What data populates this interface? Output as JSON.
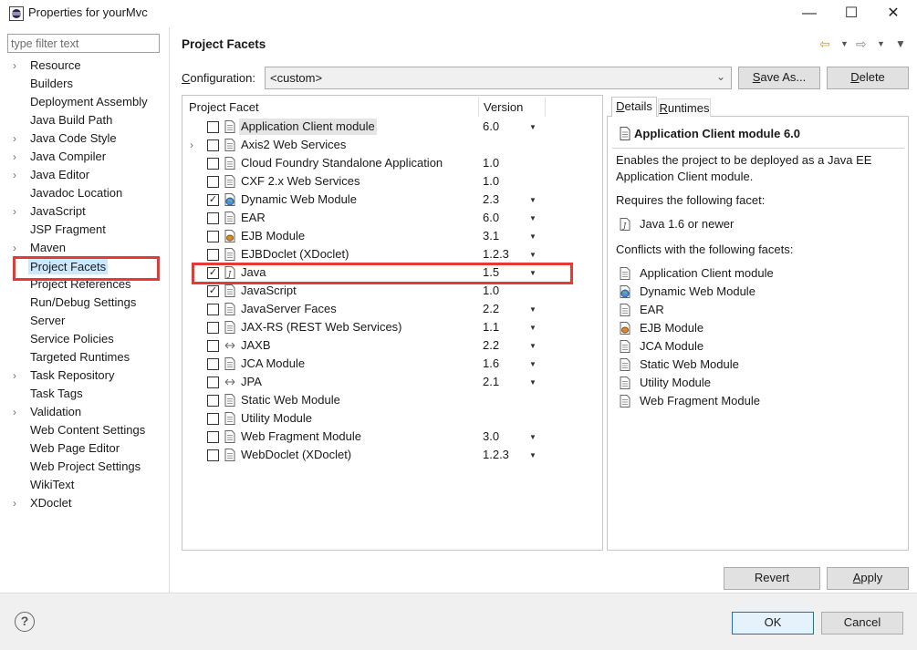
{
  "window": {
    "title": "Properties for yourMvc",
    "min_glyph": "—",
    "max_glyph": "☐",
    "close_glyph": "✕"
  },
  "filter": {
    "placeholder": "type filter text"
  },
  "nav": {
    "items": [
      {
        "label": "Resource",
        "expandable": true
      },
      {
        "label": "Builders",
        "expandable": false
      },
      {
        "label": "Deployment Assembly",
        "expandable": false
      },
      {
        "label": "Java Build Path",
        "expandable": false
      },
      {
        "label": "Java Code Style",
        "expandable": true
      },
      {
        "label": "Java Compiler",
        "expandable": true
      },
      {
        "label": "Java Editor",
        "expandable": true
      },
      {
        "label": "Javadoc Location",
        "expandable": false
      },
      {
        "label": "JavaScript",
        "expandable": true
      },
      {
        "label": "JSP Fragment",
        "expandable": false
      },
      {
        "label": "Maven",
        "expandable": true
      },
      {
        "label": "Project Facets",
        "expandable": false,
        "selected": true
      },
      {
        "label": "Project References",
        "expandable": false
      },
      {
        "label": "Run/Debug Settings",
        "expandable": false
      },
      {
        "label": "Server",
        "expandable": false
      },
      {
        "label": "Service Policies",
        "expandable": false
      },
      {
        "label": "Targeted Runtimes",
        "expandable": false
      },
      {
        "label": "Task Repository",
        "expandable": true
      },
      {
        "label": "Task Tags",
        "expandable": false
      },
      {
        "label": "Validation",
        "expandable": true
      },
      {
        "label": "Web Content Settings",
        "expandable": false
      },
      {
        "label": "Web Page Editor",
        "expandable": false
      },
      {
        "label": "Web Project Settings",
        "expandable": false
      },
      {
        "label": "WikiText",
        "expandable": false
      },
      {
        "label": "XDoclet",
        "expandable": true
      }
    ]
  },
  "header": {
    "title": "Project Facets"
  },
  "config": {
    "label_prefix": "C",
    "label_rest": "onfiguration:",
    "value": "<custom>",
    "save_as_label_prefix": "S",
    "save_as_label_rest": "ave As...",
    "delete_label_prefix": "D",
    "delete_label_rest": "elete"
  },
  "facets": {
    "col_facet": "Project Facet",
    "col_version": "Version",
    "rows": [
      {
        "name": "Application Client module",
        "version": "6.0",
        "checked": false,
        "dropdown": true,
        "expander": false,
        "icon": "page-icon",
        "highlight": true
      },
      {
        "name": "Axis2 Web Services",
        "version": "",
        "checked": false,
        "dropdown": false,
        "expander": true,
        "icon": "page-icon"
      },
      {
        "name": "Cloud Foundry Standalone Application",
        "version": "1.0",
        "checked": false,
        "dropdown": false,
        "expander": false,
        "icon": "page-icon"
      },
      {
        "name": "CXF 2.x Web Services",
        "version": "1.0",
        "checked": false,
        "dropdown": false,
        "expander": false,
        "icon": "page-icon"
      },
      {
        "name": "Dynamic Web Module",
        "version": "2.3",
        "checked": true,
        "dropdown": true,
        "expander": false,
        "icon": "globe-icon"
      },
      {
        "name": "EAR",
        "version": "6.0",
        "checked": false,
        "dropdown": true,
        "expander": false,
        "icon": "page-icon"
      },
      {
        "name": "EJB Module",
        "version": "3.1",
        "checked": false,
        "dropdown": true,
        "expander": false,
        "icon": "bean-icon"
      },
      {
        "name": "EJBDoclet (XDoclet)",
        "version": "1.2.3",
        "checked": false,
        "dropdown": true,
        "expander": false,
        "icon": "page-icon"
      },
      {
        "name": "Java",
        "version": "1.5",
        "checked": true,
        "dropdown": true,
        "expander": false,
        "icon": "java-icon"
      },
      {
        "name": "JavaScript",
        "version": "1.0",
        "checked": true,
        "dropdown": false,
        "expander": false,
        "icon": "page-icon"
      },
      {
        "name": "JavaServer Faces",
        "version": "2.2",
        "checked": false,
        "dropdown": true,
        "expander": false,
        "icon": "page-icon"
      },
      {
        "name": "JAX-RS (REST Web Services)",
        "version": "1.1",
        "checked": false,
        "dropdown": true,
        "expander": false,
        "icon": "page-icon"
      },
      {
        "name": "JAXB",
        "version": "2.2",
        "checked": false,
        "dropdown": true,
        "expander": false,
        "icon": "arrows-icon"
      },
      {
        "name": "JCA Module",
        "version": "1.6",
        "checked": false,
        "dropdown": true,
        "expander": false,
        "icon": "page-icon"
      },
      {
        "name": "JPA",
        "version": "2.1",
        "checked": false,
        "dropdown": true,
        "expander": false,
        "icon": "arrows-icon"
      },
      {
        "name": "Static Web Module",
        "version": "",
        "checked": false,
        "dropdown": false,
        "expander": false,
        "icon": "page-icon"
      },
      {
        "name": "Utility Module",
        "version": "",
        "checked": false,
        "dropdown": false,
        "expander": false,
        "icon": "page-icon"
      },
      {
        "name": "Web Fragment Module",
        "version": "3.0",
        "checked": false,
        "dropdown": true,
        "expander": false,
        "icon": "page-icon"
      },
      {
        "name": "WebDoclet (XDoclet)",
        "version": "1.2.3",
        "checked": false,
        "dropdown": true,
        "expander": false,
        "icon": "page-icon"
      }
    ]
  },
  "details": {
    "tab_details_prefix": "D",
    "tab_details_rest": "etails",
    "tab_runtimes_prefix": "R",
    "tab_runtimes_rest": "untimes",
    "title": "Application Client module 6.0",
    "description": "Enables the project to be deployed as a Java EE Application Client module.",
    "requires_label": "Requires the following facet:",
    "requires": [
      {
        "label": "Java 1.6 or newer",
        "icon": "java-icon"
      }
    ],
    "conflicts_label": "Conflicts with the following facets:",
    "conflicts": [
      {
        "label": "Application Client module",
        "icon": "page-icon"
      },
      {
        "label": "Dynamic Web Module",
        "icon": "globe-icon"
      },
      {
        "label": "EAR",
        "icon": "page-icon"
      },
      {
        "label": "EJB Module",
        "icon": "bean-icon"
      },
      {
        "label": "JCA Module",
        "icon": "page-icon"
      },
      {
        "label": "Static Web Module",
        "icon": "page-icon"
      },
      {
        "label": "Utility Module",
        "icon": "page-icon"
      },
      {
        "label": "Web Fragment Module",
        "icon": "page-icon"
      }
    ]
  },
  "buttons": {
    "revert": "Revert",
    "apply_prefix": "A",
    "apply_rest": "pply",
    "ok": "OK",
    "cancel": "Cancel",
    "help_glyph": "?"
  },
  "colors": {
    "selection": "#cce8ff",
    "annotation_red": "#e53935",
    "default_button_border": "#0078d7"
  }
}
